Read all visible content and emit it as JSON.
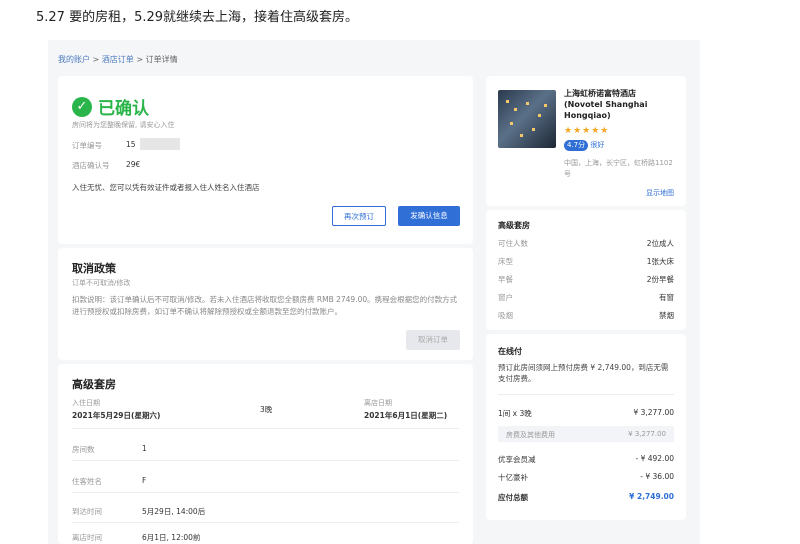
{
  "caption": "5.27 要的房租，5.29就继续去上海，接着住高级套房。",
  "breadcrumb": {
    "my_account": "我的账户",
    "hotel_orders": "酒店订单",
    "order_detail": "订单详情",
    "sep": " > "
  },
  "status": {
    "title": "已确认",
    "subtitle": "房间将为您整晚保留, 请安心入住",
    "order_no_label": "订单编号",
    "order_no_value": "15",
    "confirm_no_label": "酒店确认号",
    "confirm_no_value": "29€",
    "note": "入住无忧、您可以凭有效证件或者报入住人姓名入住酒店",
    "rebook_btn": "再次预订",
    "send_confirm_btn": "发确认信息"
  },
  "cancel": {
    "title": "取消政策",
    "sub": "订单不可取消/修改",
    "desc": "扣款说明：该订单确认后不可取消/修改。若未入住酒店将收取您全额房费 RMB 2749.00。携程会根据您的付款方式进行预授权或扣除房费，如订单不确认将解除预授权或全额退款至您的付款账户。",
    "cancel_btn": "取消订单"
  },
  "room": {
    "title": "高级套房",
    "checkin_label": "入住日期",
    "checkin_value": "2021年5月29日(星期六)",
    "nights": "3晚",
    "checkout_label": "离店日期",
    "checkout_value": "2021年6月1日(星期二)",
    "rows": [
      {
        "label": "房间数",
        "value": "1"
      },
      {
        "label": "住客姓名",
        "value": "F"
      },
      {
        "label": "到达时间",
        "value": "5月29日, 14:00后"
      },
      {
        "label": "离店时间",
        "value": "6月1日, 12:00前"
      }
    ]
  },
  "hotel": {
    "name": "上海虹桥诺富特酒店 (Novotel Shanghai Hongqiao)",
    "stars": "★★★★★",
    "score": "4.7分",
    "score_text": "很好",
    "address": "中国，上海，长宁区，虹桥路1102号",
    "map_link": "显示地图"
  },
  "room_info": {
    "title": "高级套房",
    "rows": [
      {
        "label": "可住人数",
        "value": "2位成人"
      },
      {
        "label": "床型",
        "value": "1张大床"
      },
      {
        "label": "早餐",
        "value": "2份早餐"
      },
      {
        "label": "窗户",
        "value": "有窗"
      },
      {
        "label": "吸烟",
        "value": "禁烟"
      }
    ]
  },
  "payment": {
    "title": "在线付",
    "note": "预订此房间须网上预付房费 ¥ 2,749.00，到店无需支付房费。",
    "room_label": "1间 x 3晚",
    "room_value": "¥ 3,277.00",
    "fee_label": "房费及其他费用",
    "fee_value": "¥ 3,277.00",
    "discount_label": "优享会员减",
    "discount_value": "- ¥ 492.00",
    "points_label": "十亿豪补",
    "points_value": "- ¥ 36.00",
    "total_label": "应付总额",
    "total_value": "¥ 2,749.00"
  },
  "colors": {
    "accent": "#2f6fd6",
    "success": "#2ab54a",
    "star": "#f5a623"
  }
}
